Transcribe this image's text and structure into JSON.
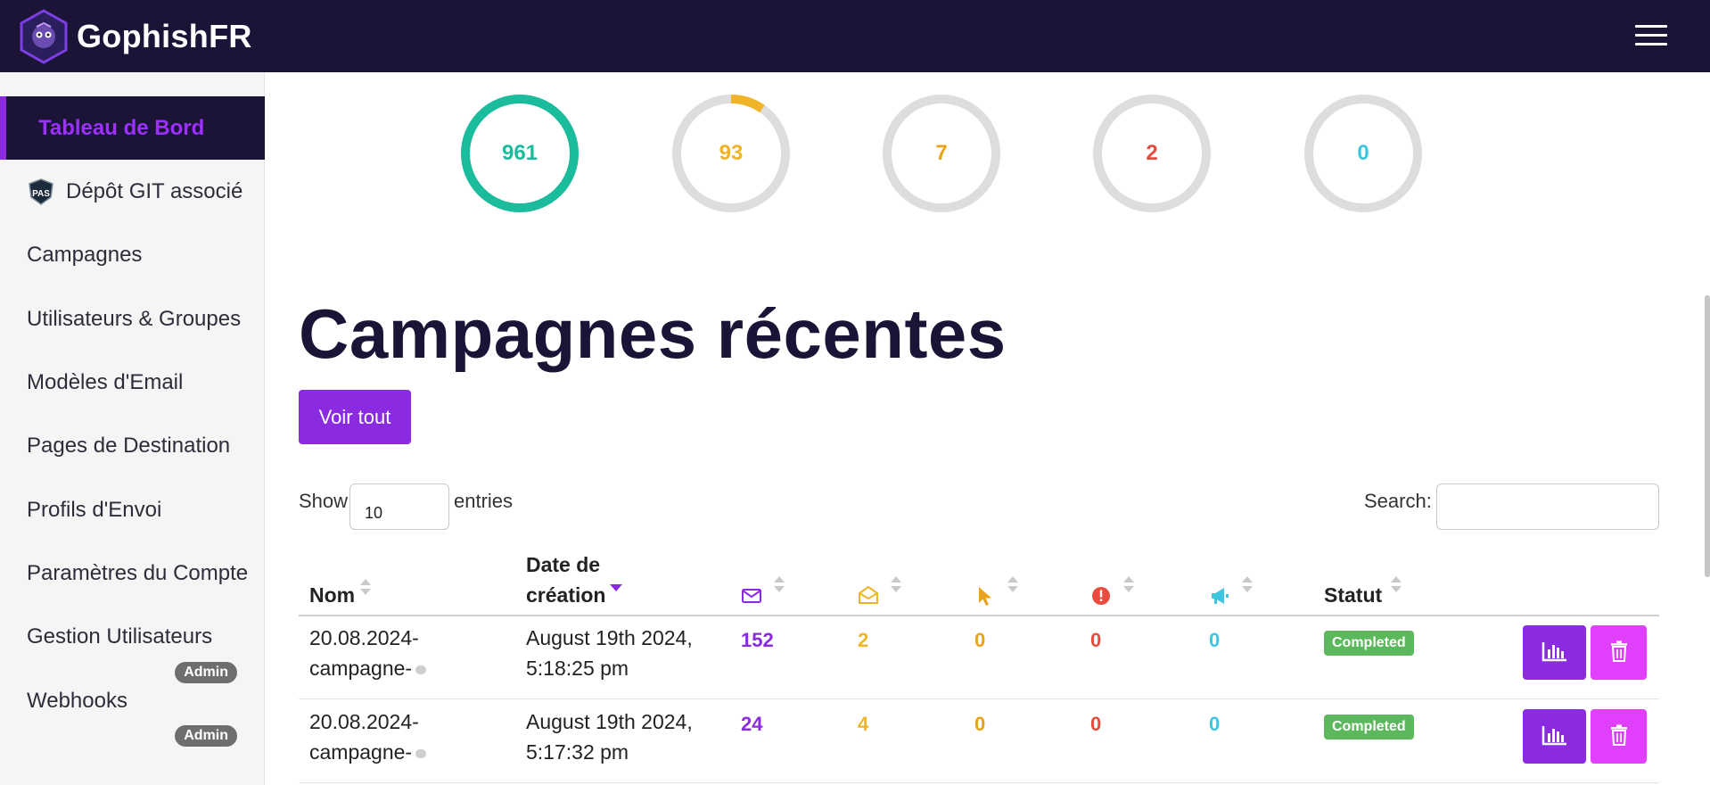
{
  "navbar": {
    "brand": "GophishFR"
  },
  "sidebar": {
    "items": [
      {
        "label": "Tableau de Bord",
        "active": true
      },
      {
        "label": "Dépôt GIT associé",
        "icon": "pas-shield-icon"
      },
      {
        "label": "Campagnes"
      },
      {
        "label": "Utilisateurs & Groupes"
      },
      {
        "label": "Modèles d'Email"
      },
      {
        "label": "Pages de Destination"
      },
      {
        "label": "Profils d'Envoi"
      },
      {
        "label": "Paramètres du Compte"
      },
      {
        "label": "Gestion Utilisateurs",
        "badge": "Admin"
      },
      {
        "label": "Webhooks",
        "badge": "Admin"
      }
    ]
  },
  "stats": [
    {
      "value": "961",
      "color": "#1abc9c",
      "fraction": 1.0
    },
    {
      "value": "93",
      "color": "#f0b429",
      "fraction": 0.097
    },
    {
      "value": "7",
      "color": "#e8a317",
      "fraction": 0.0
    },
    {
      "value": "2",
      "color": "#e74c3c",
      "fraction": 0.0
    },
    {
      "value": "0",
      "color": "#3ec6e0",
      "fraction": 0.0
    }
  ],
  "recent": {
    "title": "Campagnes récentes",
    "view_all": "Voir tout",
    "show_label": "Show",
    "length_value": "10",
    "entries_label": "entries",
    "search_label": "Search:"
  },
  "table": {
    "headers": {
      "name": "Nom",
      "date_line1": "Date de",
      "date_line2": "création",
      "status": "Statut"
    },
    "rows": [
      {
        "name_line1": "20.08.2024-",
        "name_line2": "campagne-",
        "date_line1": "August 19th 2024,",
        "date_line2": "5:18:25 pm",
        "sent": "152",
        "opened": "2",
        "clicked": "0",
        "submitted": "0",
        "reported": "0",
        "status": "Completed"
      },
      {
        "name_line1": "20.08.2024-",
        "name_line2": "campagne-",
        "date_line1": "August 19th 2024,",
        "date_line2": "5:17:32 pm",
        "sent": "24",
        "opened": "4",
        "clicked": "0",
        "submitted": "0",
        "reported": "0",
        "status": "Completed"
      }
    ]
  },
  "colors": {
    "brand_dark": "#1c1437",
    "accent": "#8a2be2",
    "delete": "#e040fb",
    "sent": "#8a2be2",
    "opened": "#f0b429",
    "clicked": "#e8a317",
    "submitted": "#e74c3c",
    "reported": "#3ec6e0",
    "completed": "#5cb85c"
  }
}
